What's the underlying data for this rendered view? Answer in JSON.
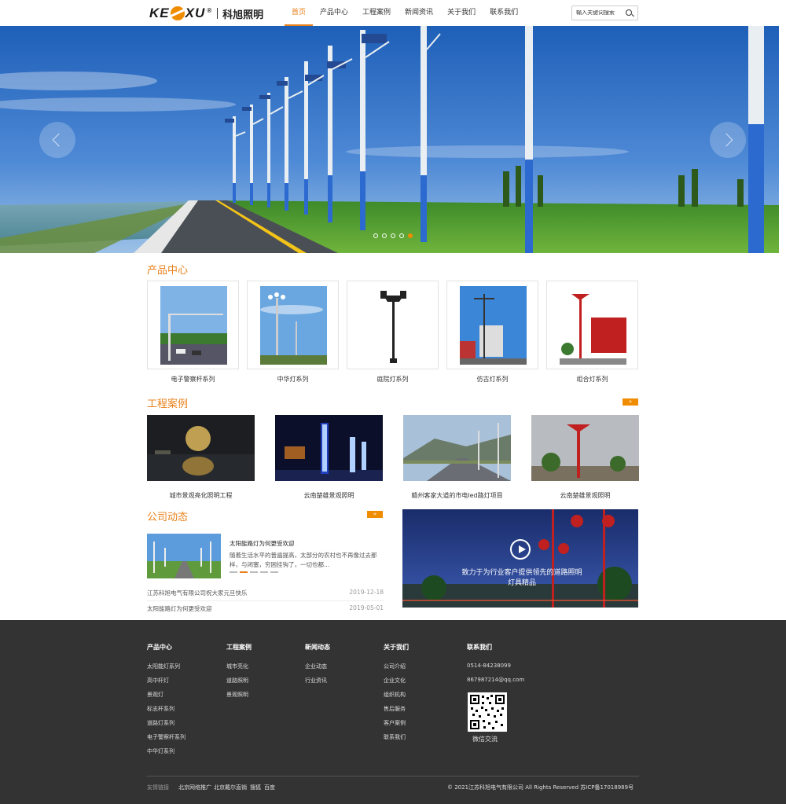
{
  "brand": {
    "logo_text_before": "KE",
    "logo_text_after": "XU",
    "logo_reg": "®",
    "company_cn": "科旭照明"
  },
  "nav": [
    {
      "label": "首页",
      "active": true
    },
    {
      "label": "产品中心"
    },
    {
      "label": "工程案例"
    },
    {
      "label": "新闻资讯"
    },
    {
      "label": "关于我们"
    },
    {
      "label": "联系我们"
    }
  ],
  "search": {
    "placeholder": "输入关键词搜索"
  },
  "banner": {
    "slide_count": 5,
    "active_slide": 5
  },
  "products": {
    "title": "产品中心",
    "items": [
      {
        "label": "电子警察杆系列",
        "icon": "traffic-pole-photo"
      },
      {
        "label": "中华灯系列",
        "icon": "chinese-lamp-photo"
      },
      {
        "label": "庭院灯系列",
        "icon": "garden-lamp-photo"
      },
      {
        "label": "仿古灯系列",
        "icon": "antique-lamp-photo"
      },
      {
        "label": "组合灯系列",
        "icon": "combo-lamp-photo"
      }
    ]
  },
  "cases": {
    "title": "工程案例",
    "more": "»",
    "items": [
      {
        "label": "城市景观亮化照明工程"
      },
      {
        "label": "云南楚雄景观照明"
      },
      {
        "label": "赣州客家大道的市电led路灯项目"
      },
      {
        "label": "云南楚雄景观照明"
      }
    ]
  },
  "news": {
    "title": "公司动态",
    "more": "»",
    "featured": {
      "headline": "太阳能路灯为何更受欢迎",
      "summary": "随着生活水平的普遍提高，太部分的农村也不再像过去那样，与闭塞，穷困挂钩了，一切也都..."
    },
    "list": [
      {
        "title": "江苏科旭电气有限公司祝大家元旦快乐",
        "date": "2019-12-18"
      },
      {
        "title": "太阳能路灯为何更受欢迎",
        "date": "2019-05-01"
      }
    ]
  },
  "video": {
    "caption": "致力于为行业客户提供领先的道路照明灯具精品"
  },
  "footer": {
    "columns": [
      {
        "title": "产品中心",
        "items": [
          "太阳能灯系列",
          "高中杆灯",
          "景观灯",
          "标志杆系列",
          "道路灯系列",
          "电子警察杆系列",
          "中华灯系列"
        ]
      },
      {
        "title": "工程案例",
        "items": [
          "城市亮化",
          "道路照明",
          "景观照明"
        ]
      },
      {
        "title": "新闻动态",
        "items": [
          "企业动态",
          "行业资讯"
        ]
      },
      {
        "title": "关于我们",
        "items": [
          "公司介绍",
          "企业文化",
          "组织机构",
          "售后服务",
          "客户案例",
          "联系我们"
        ]
      },
      {
        "title": "联系我们",
        "items": [
          "0514-84238099",
          "867987214@qq.com"
        ]
      }
    ],
    "qr_label": "微信交流",
    "links_label": "友情链接",
    "links": [
      "北京网络推广",
      "北京戴尔直销",
      "搜狐",
      "百度"
    ],
    "copyright": "© 2021江苏科旭电气有限公司 All Rights Reserved    苏ICP备17018989号"
  },
  "colors": {
    "accent": "#e8801a",
    "footer_bg": "#333333"
  }
}
